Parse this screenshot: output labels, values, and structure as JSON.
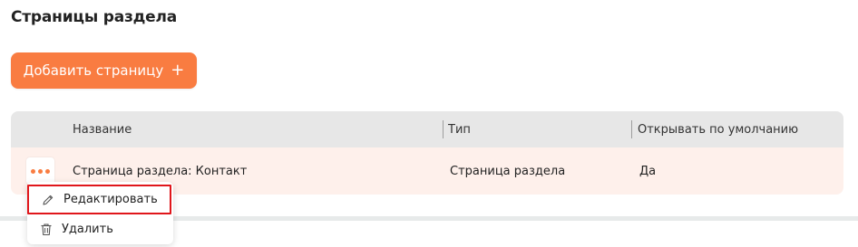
{
  "section": {
    "title": "Страницы раздела",
    "add_button_label": "Добавить страницу",
    "add_button_icon": "+"
  },
  "table": {
    "columns": [
      "Название",
      "Тип",
      "Открывать по умолчанию"
    ],
    "rows": [
      {
        "name": "Страница раздела: Контакт",
        "type": "Страница раздела",
        "open_by_default": "Да"
      }
    ]
  },
  "row_menu": {
    "items": [
      {
        "label": "Редактировать",
        "icon": "pencil-icon",
        "highlighted": true
      },
      {
        "label": "Удалить",
        "icon": "trash-icon",
        "highlighted": false
      }
    ]
  },
  "colors": {
    "accent": "#f97c41",
    "header_bg": "#e7e7e7",
    "row_bg": "#fef0eb",
    "highlight_border": "#e0161b"
  }
}
